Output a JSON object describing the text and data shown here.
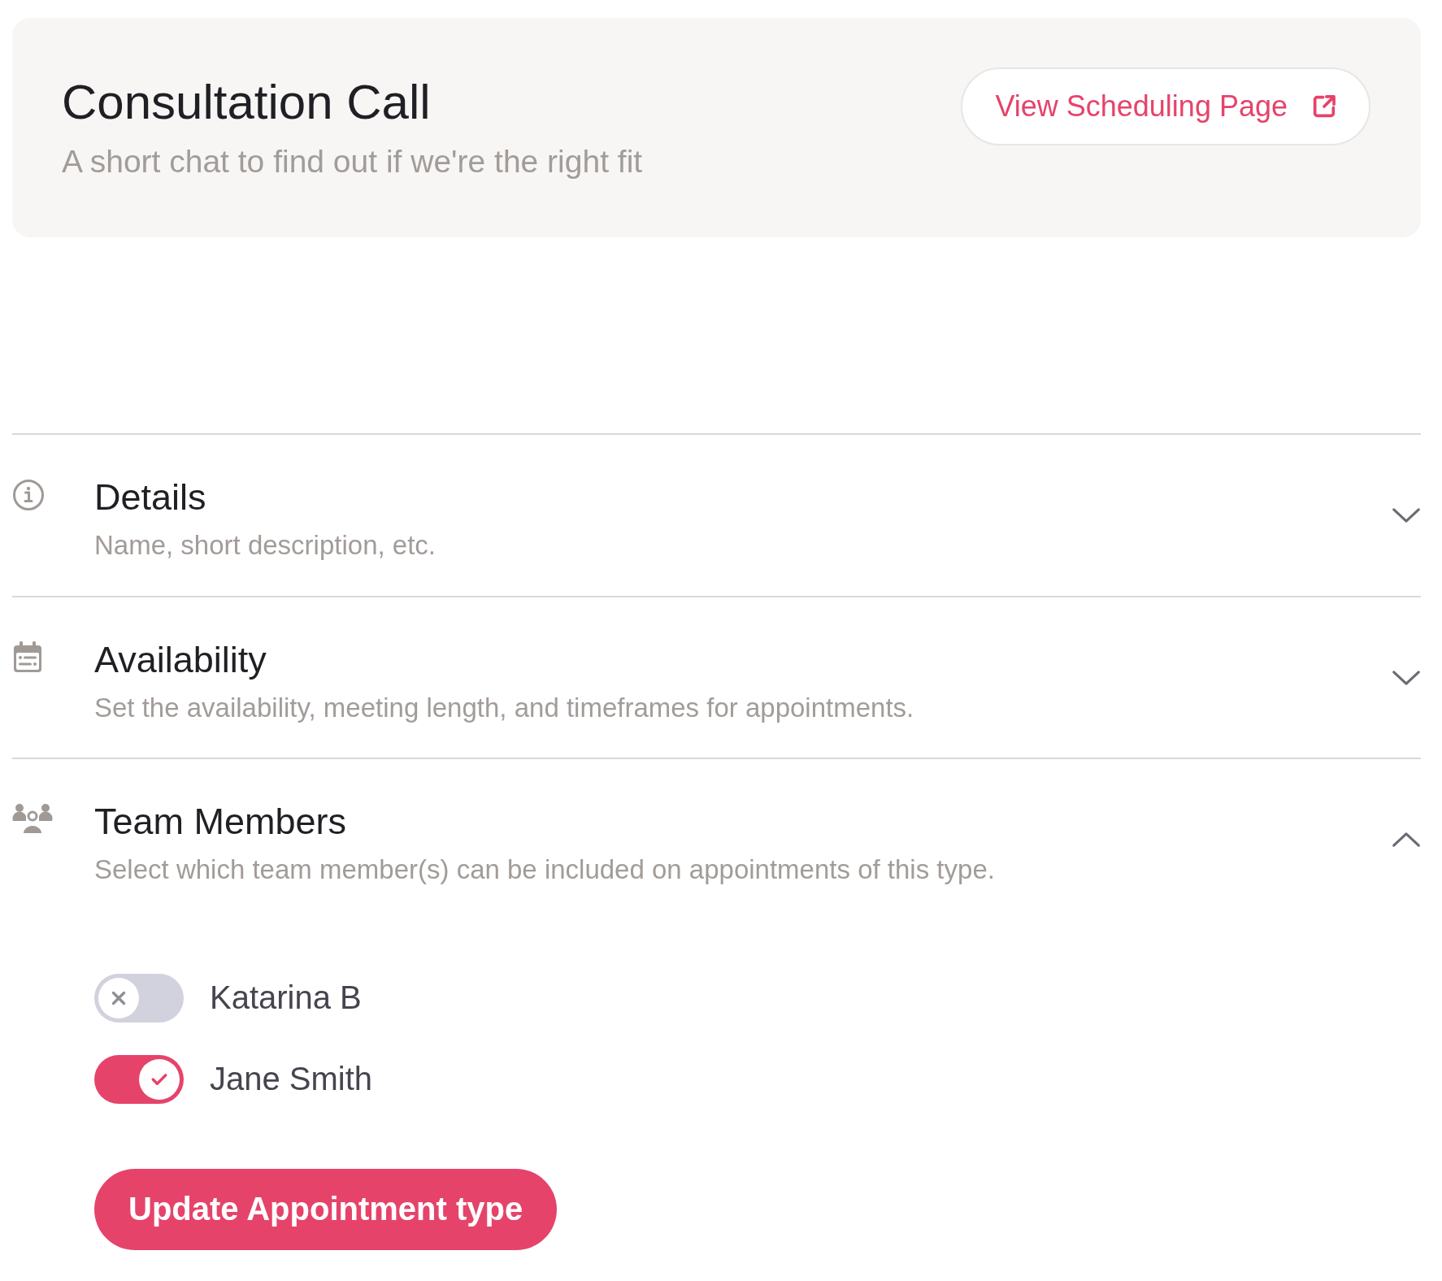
{
  "header": {
    "title": "Consultation Call",
    "subtitle": "A short chat to find out if we're the right fit",
    "button": "View Scheduling Page"
  },
  "sections": [
    {
      "kind": "details",
      "title": "Details",
      "subtitle": "Name, short description, etc.",
      "expanded": false
    },
    {
      "kind": "availability",
      "title": "Availability",
      "subtitle": "Set the availability, meeting length, and timeframes for appointments.",
      "expanded": false
    },
    {
      "kind": "team",
      "title": "Team Members",
      "subtitle": "Select which team member(s) can be included on appointments of this type.",
      "expanded": true
    }
  ],
  "members": [
    {
      "name": "Katarina B",
      "on": false
    },
    {
      "name": "Jane Smith",
      "on": true
    }
  ],
  "submit": "Update Appointment type"
}
